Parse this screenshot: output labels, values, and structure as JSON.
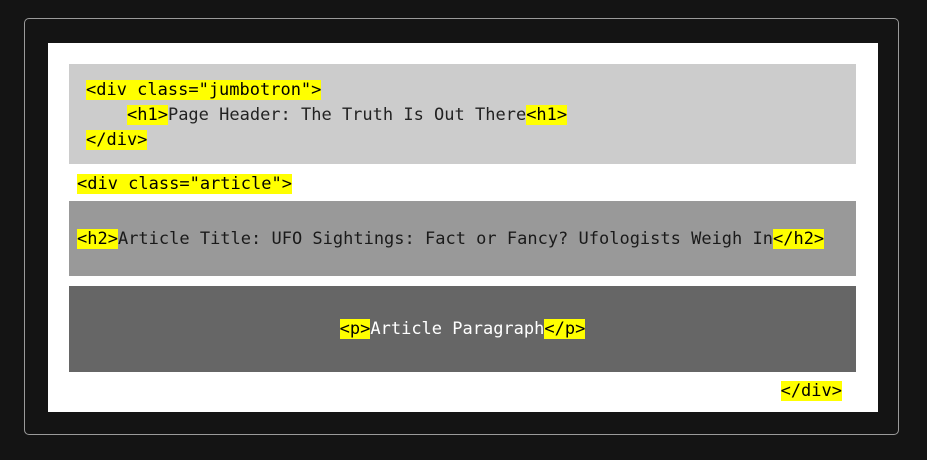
{
  "jumbotron": {
    "open_tag": "<div class=\"jumbotron\">",
    "h1_open": "<h1>",
    "h1_text": "Page Header: The Truth Is Out There",
    "h1_close": "<h1>",
    "close_tag": "</div>"
  },
  "article": {
    "open_tag": "<div class=\"article\">",
    "h2_open": "<h2>",
    "h2_text": "Article Title: UFO Sightings: Fact or Fancy? Ufologists Weigh In",
    "h2_close": "</h2>",
    "p_open": "<p>",
    "p_text": "Article Paragraph",
    "p_close": "</p>",
    "close_tag": "</div>"
  },
  "colors": {
    "background": "#141414",
    "panel": "#ffffff",
    "jumbotron_fill": "#cccccc",
    "h2_fill": "#999999",
    "p_fill": "#666666",
    "tag_highlight": "#ffff00"
  }
}
